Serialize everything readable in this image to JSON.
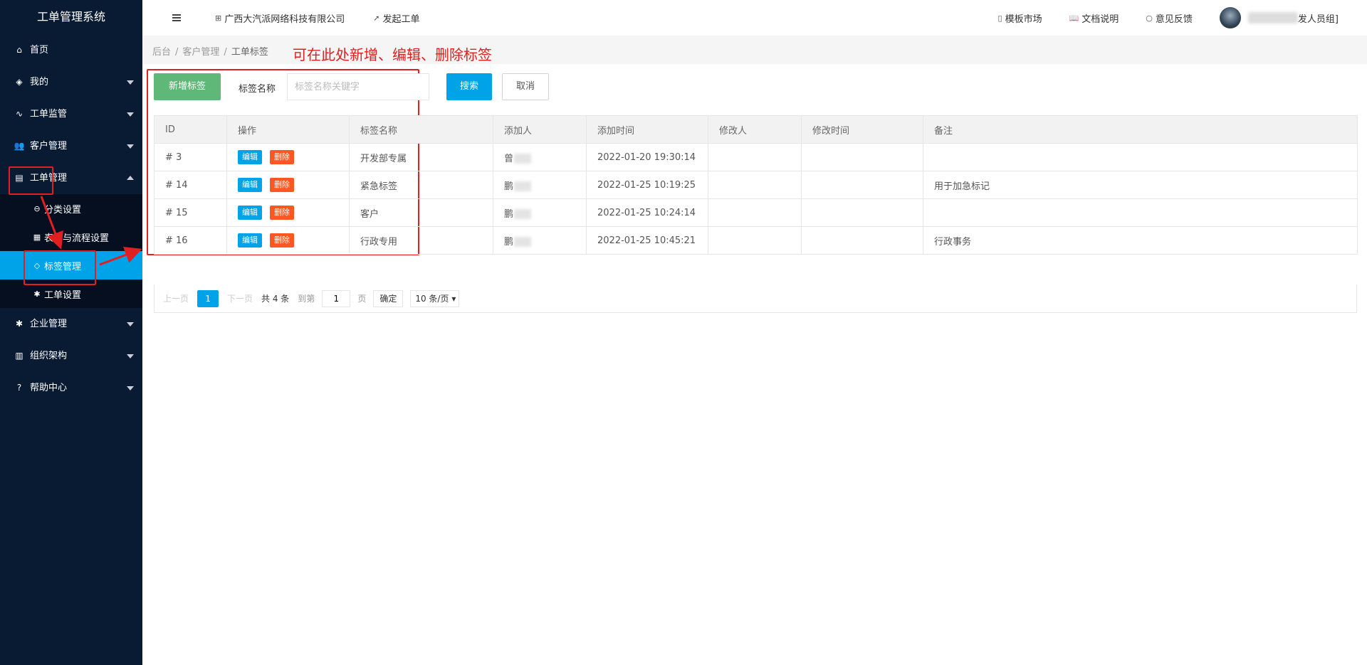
{
  "app": {
    "title": "工单管理系统"
  },
  "sidebar": {
    "items": [
      {
        "label": "首页",
        "icon": "home-icon"
      },
      {
        "label": "我的",
        "icon": "layers-icon"
      },
      {
        "label": "工单监管",
        "icon": "pulse-icon"
      },
      {
        "label": "客户管理",
        "icon": "users-icon"
      },
      {
        "label": "工单管理",
        "icon": "clipboard-icon",
        "expanded": true
      },
      {
        "label": "企业管理",
        "icon": "gear-icon"
      },
      {
        "label": "组织架构",
        "icon": "org-icon"
      },
      {
        "label": "帮助中心",
        "icon": "question-icon"
      }
    ],
    "submenu": [
      {
        "label": "分类设置",
        "icon": "category-icon"
      },
      {
        "label": "表单与流程设置",
        "icon": "grid-icon"
      },
      {
        "label": "标签管理",
        "icon": "tag-icon",
        "active": true
      },
      {
        "label": "工单设置",
        "icon": "gear-icon"
      }
    ]
  },
  "header": {
    "company": "广西大汽派网络科技有限公司",
    "launch": "发起工单",
    "template_market": "模板市场",
    "docs": "文档说明",
    "feedback": "意见反馈",
    "user_suffix": "发人员组]"
  },
  "breadcrumb": {
    "items": [
      "后台",
      "客户管理",
      "工单标签"
    ]
  },
  "annotation": "可在此处新增、编辑、删除标签",
  "toolbar": {
    "add_label": "新增标签",
    "name_label": "标签名称",
    "search_placeholder": "标签名称关键字",
    "search_value": "",
    "search_btn": "搜索",
    "cancel_btn": "取消"
  },
  "table": {
    "headers": [
      "ID",
      "操作",
      "标签名称",
      "添加人",
      "添加时间",
      "修改人",
      "修改时间",
      "备注"
    ],
    "edit_label": "编辑",
    "delete_label": "删除",
    "rows": [
      {
        "id": "# 3",
        "name": "开发部专属",
        "adder": "曾",
        "added": "2022-01-20 19:30:14",
        "modifier": "",
        "modified": "",
        "note": ""
      },
      {
        "id": "# 14",
        "name": "紧急标签",
        "adder": "鹏",
        "added": "2022-01-25 10:19:25",
        "modifier": "",
        "modified": "",
        "note": "用于加急标记"
      },
      {
        "id": "# 15",
        "name": "客户",
        "adder": "鹏",
        "added": "2022-01-25 10:24:14",
        "modifier": "",
        "modified": "",
        "note": ""
      },
      {
        "id": "# 16",
        "name": "行政专用",
        "adder": "鹏",
        "added": "2022-01-25 10:45:21",
        "modifier": "",
        "modified": "",
        "note": "行政事务"
      }
    ]
  },
  "pager": {
    "prev": "上一页",
    "current": "1",
    "next": "下一页",
    "total": "共 4 条",
    "goto": "到第",
    "goto_value": "1",
    "page_unit": "页",
    "confirm": "确定",
    "page_size": "10 条/页"
  },
  "colors": {
    "sidebar_bg": "#091a33",
    "accent": "#00a2e8",
    "add_button": "#5fb878",
    "delete_button": "#ff5722",
    "annotation": "#e02020"
  }
}
